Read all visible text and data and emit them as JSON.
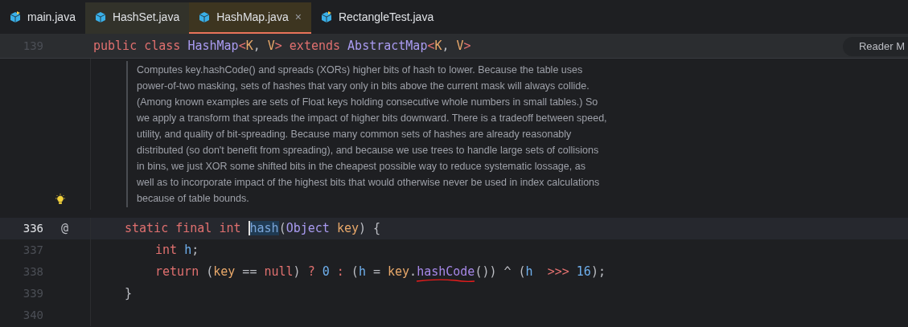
{
  "tabs": [
    {
      "label": "main.java",
      "selected": false,
      "hovered": false,
      "closable": false,
      "kind": "runnable"
    },
    {
      "label": "HashSet.java",
      "selected": false,
      "hovered": true,
      "closable": false,
      "kind": "class"
    },
    {
      "label": "HashMap.java",
      "selected": true,
      "hovered": false,
      "closable": true,
      "close": "×",
      "kind": "class"
    },
    {
      "label": "RectangleTest.java",
      "selected": false,
      "hovered": false,
      "closable": false,
      "kind": "runnable"
    }
  ],
  "sticky_line": {
    "number": "139",
    "tokens": [
      {
        "t": "public class ",
        "kind": "keyword"
      },
      {
        "t": "HashMap",
        "kind": "type"
      },
      {
        "t": "<",
        "kind": "keyword"
      },
      {
        "t": "K",
        "kind": "param"
      },
      {
        "t": ", ",
        "kind": "punct"
      },
      {
        "t": "V",
        "kind": "param"
      },
      {
        "t": "> ",
        "kind": "keyword"
      },
      {
        "t": "extends ",
        "kind": "keyword"
      },
      {
        "t": "AbstractMap",
        "kind": "type"
      },
      {
        "t": "<",
        "kind": "keyword"
      },
      {
        "t": "K",
        "kind": "param"
      },
      {
        "t": ", ",
        "kind": "punct"
      },
      {
        "t": "V",
        "kind": "param"
      },
      {
        "t": ">",
        "kind": "keyword"
      }
    ]
  },
  "reader_mode": "Reader M",
  "doc_comment": [
    "Computes key.hashCode() and spreads (XORs) higher bits of hash to lower. Because the table uses",
    "power-of-two masking, sets of hashes that vary only in bits above the current mask will always collide.",
    "(Among known examples are sets of Float keys holding consecutive whole numbers in small tables.) So",
    "we apply a transform that spreads the impact of higher bits downward. There is a tradeoff between speed,",
    "utility, and quality of bit-spreading. Because many common sets of hashes are already reasonably",
    "distributed (so don't benefit from spreading), and because we use trees to handle large sets of collisions",
    "in bins, we just XOR some shifted bits in the cheapest possible way to reduce systematic lossage, as",
    "well as to incorporate impact of the highest bits that would otherwise never be used in index calculations",
    "because of table bounds."
  ],
  "lines": [
    {
      "number": "336",
      "current": true,
      "gutter_mark": "@",
      "kind": "member",
      "tokens": [
        {
          "t": "static final int ",
          "kind": "keyword"
        },
        {
          "t": "hash",
          "kind": "method",
          "highlighted": true
        },
        {
          "t": "(",
          "kind": "punct"
        },
        {
          "t": "Object ",
          "kind": "type"
        },
        {
          "t": "key",
          "kind": "param"
        },
        {
          "t": ") {",
          "kind": "punct"
        }
      ]
    },
    {
      "number": "337",
      "current": false,
      "kind": "body",
      "tokens": [
        {
          "t": "int ",
          "kind": "keyword"
        },
        {
          "t": "h",
          "kind": "var"
        },
        {
          "t": ";",
          "kind": "punct"
        }
      ]
    },
    {
      "number": "338",
      "current": false,
      "kind": "body",
      "tokens": [
        {
          "t": "return ",
          "kind": "keyword"
        },
        {
          "t": "(",
          "kind": "punct"
        },
        {
          "t": "key",
          "kind": "param"
        },
        {
          "t": " == ",
          "kind": "punct"
        },
        {
          "t": "null",
          "kind": "keyword"
        },
        {
          "t": ") ",
          "kind": "punct"
        },
        {
          "t": "?",
          "kind": "keyword"
        },
        {
          "t": " 0 ",
          "kind": "number"
        },
        {
          "t": ": ",
          "kind": "keyword"
        },
        {
          "t": "(",
          "kind": "punct"
        },
        {
          "t": "h",
          "kind": "var"
        },
        {
          "t": " = ",
          "kind": "punct"
        },
        {
          "t": "key",
          "kind": "param"
        },
        {
          "t": ".",
          "kind": "punct"
        },
        {
          "t": "hashCode",
          "kind": "call",
          "error": true
        },
        {
          "t": "()) ^ (",
          "kind": "punct"
        },
        {
          "t": "h",
          "kind": "var"
        },
        {
          "t": "  >>> ",
          "kind": "keyword"
        },
        {
          "t": "16",
          "kind": "number"
        },
        {
          "t": ");",
          "kind": "punct"
        }
      ]
    },
    {
      "number": "339",
      "current": false,
      "kind": "member",
      "tokens": [
        {
          "t": "}",
          "kind": "punct"
        }
      ]
    },
    {
      "number": "340",
      "current": false,
      "kind": "member"
    }
  ]
}
